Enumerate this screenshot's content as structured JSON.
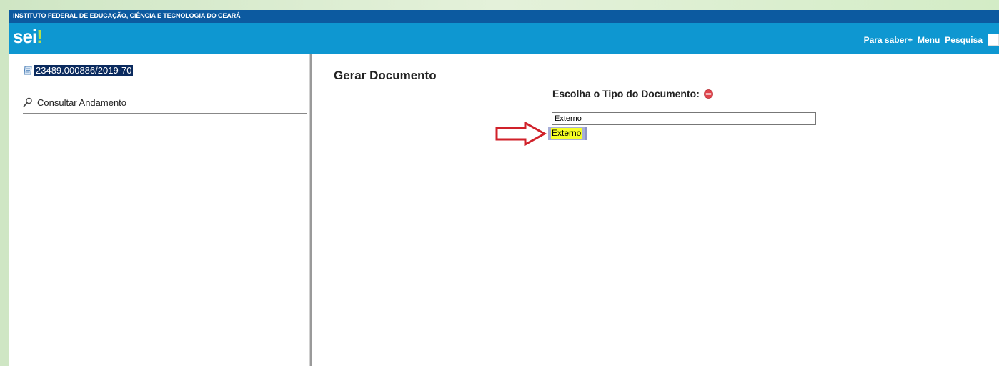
{
  "header": {
    "org_name": "INSTITUTO FEDERAL DE EDUCAÇÃO, CIÊNCIA E TECNOLOGIA DO CEARÁ",
    "logo_text": "sei",
    "logo_mark": "!",
    "nav": {
      "para_saber": "Para saber+",
      "menu": "Menu",
      "pesquisa": "Pesquisa"
    }
  },
  "sidebar": {
    "process_number": "23489.000886/2019-70",
    "process_icon": "document-icon",
    "consult_label": "Consultar Andamento",
    "consult_icon": "magnifier-icon"
  },
  "main": {
    "title": "Gerar Documento",
    "doc_type_label": "Escolha o Tipo do Documento:",
    "doc_type_input_value": "Externo",
    "suggestion": "Externo",
    "annotation_arrow_color": "#d0212a"
  },
  "colors": {
    "topbar": "#0c5aa0",
    "header": "#0e97d1",
    "process_highlight": "#0a2a5e",
    "suggestion_bg": "#a7aed8",
    "suggestion_highlight": "#f5ff25"
  }
}
